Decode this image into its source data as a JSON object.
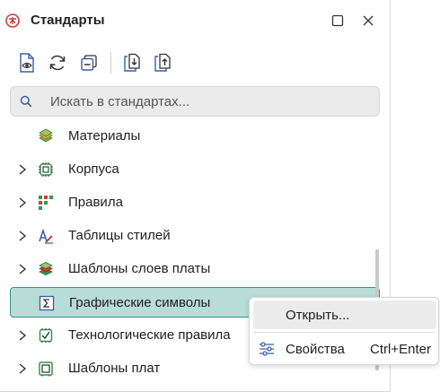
{
  "panel": {
    "title": "Стандарты",
    "icons": {
      "app": "standards-logo-icon",
      "maximize": "maximize-icon",
      "close": "close-icon"
    }
  },
  "toolbar": {
    "buttons": [
      {
        "name": "view-document-button",
        "icon": "document-eye-icon"
      },
      {
        "name": "refresh-button",
        "icon": "refresh-icon"
      },
      {
        "name": "collapse-all-button",
        "icon": "collapse-icon"
      },
      {
        "name": "import-button",
        "icon": "import-icon"
      },
      {
        "name": "export-button",
        "icon": "export-icon"
      }
    ]
  },
  "search": {
    "placeholder": "Искать в стандартах...",
    "value": ""
  },
  "tree": {
    "items": [
      {
        "label": "Материалы",
        "icon": "materials-icon",
        "expandable": false,
        "selected": false
      },
      {
        "label": "Корпуса",
        "icon": "package-chip-icon",
        "expandable": true,
        "selected": false
      },
      {
        "label": "Правила",
        "icon": "rules-grid-icon",
        "expandable": true,
        "selected": false
      },
      {
        "label": "Таблицы стилей",
        "icon": "style-tables-icon",
        "expandable": true,
        "selected": false
      },
      {
        "label": "Шаблоны слоев платы",
        "icon": "board-layers-icon",
        "expandable": true,
        "selected": false
      },
      {
        "label": "Графические символы",
        "icon": "sigma-symbol-icon",
        "expandable": false,
        "selected": true
      },
      {
        "label": "Технологические правила",
        "icon": "tech-rules-icon",
        "expandable": true,
        "selected": false
      },
      {
        "label": "Шаблоны плат",
        "icon": "board-templates-icon",
        "expandable": true,
        "selected": false
      }
    ]
  },
  "context_menu": {
    "open": {
      "label": "Открыть..."
    },
    "properties": {
      "label": "Свойства",
      "shortcut": "Ctrl+Enter",
      "icon": "sliders-icon"
    }
  },
  "colors": {
    "selected_background": "#b8dcd7",
    "selected_border": "#3e8f85",
    "icon_green": "#2e9a48",
    "icon_blue": "#3a5fa8",
    "icon_red": "#d23b3b"
  }
}
